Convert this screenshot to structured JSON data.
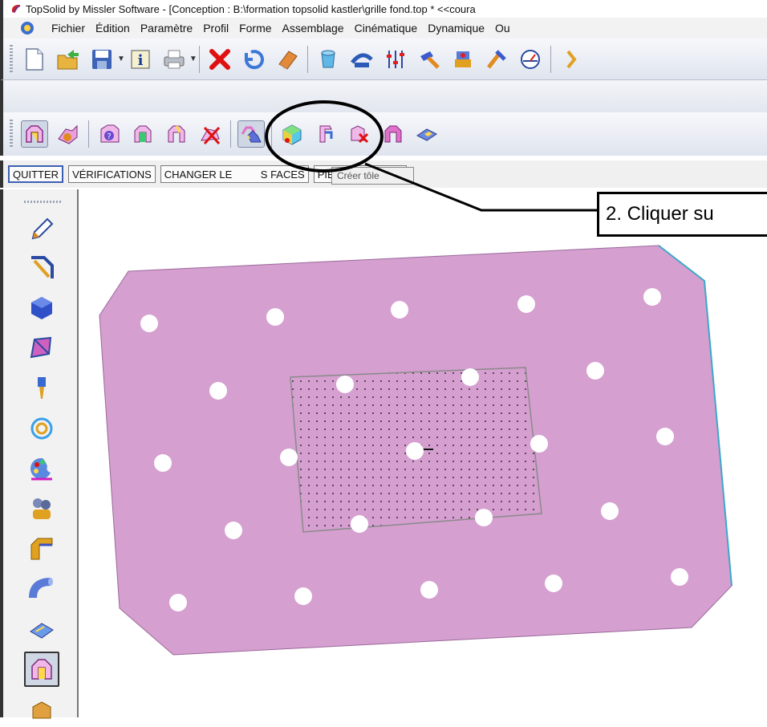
{
  "window": {
    "title": "TopSolid by Missler Software - [Conception : B:\\formation topsolid kastler\\grille fond.top *  <<coura"
  },
  "menu": {
    "items": [
      "Fichier",
      "Édition",
      "Paramètre",
      "Profil",
      "Forme",
      "Assemblage",
      "Cinématique",
      "Dynamique",
      "Ou"
    ]
  },
  "commands": {
    "quit": "QUITTER",
    "checks": "VÉRIFICATIONS",
    "change_faces_part1": "CHANGER LE",
    "change_faces_part2": "S FACES",
    "next_part": "PIÈCE SUIVANTE"
  },
  "tooltip": {
    "text": "Créer tôle"
  },
  "annotation": {
    "text": "2. Cliquer su",
    "color": "#000000"
  },
  "colors": {
    "sheet_fill": "#d59fd0",
    "sheet_edge": "#3aa8c8",
    "hole": "#ffffff",
    "accent_red": "#e01010"
  }
}
